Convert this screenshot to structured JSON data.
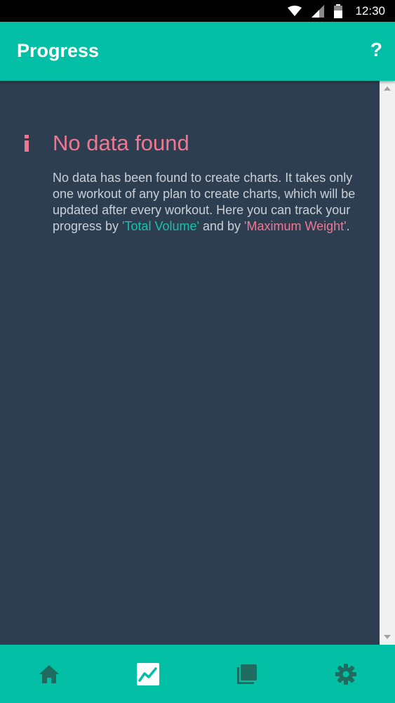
{
  "status_bar": {
    "time": "12:30",
    "icons": [
      "wifi-icon",
      "signal-icon",
      "battery-icon"
    ]
  },
  "app_bar": {
    "title": "Progress",
    "help_label": "?"
  },
  "empty_state": {
    "icon": "info-icon",
    "title": "No data found",
    "message_part1": "No data has been found to create charts. It takes only one workout of any plan to create charts, which will be updated after every workout. Here you can track your progress by ",
    "link_total_volume": "'Total Volume'",
    "message_part2": " and by ",
    "link_max_weight": "'Maximum Weight'",
    "message_part3": "."
  },
  "bottom_nav": {
    "items": [
      {
        "name": "home",
        "icon": "home-icon",
        "active": false
      },
      {
        "name": "progress",
        "icon": "chart-icon",
        "active": true
      },
      {
        "name": "plans",
        "icon": "stack-icon",
        "active": false
      },
      {
        "name": "settings",
        "icon": "gear-icon",
        "active": false
      }
    ]
  },
  "colors": {
    "primary": "#02bfa5",
    "background": "#2c3e50",
    "accent_pink": "#ee7891",
    "accent_teal": "#17c2a9",
    "nav_icon_inactive": "#1f6b5f"
  }
}
